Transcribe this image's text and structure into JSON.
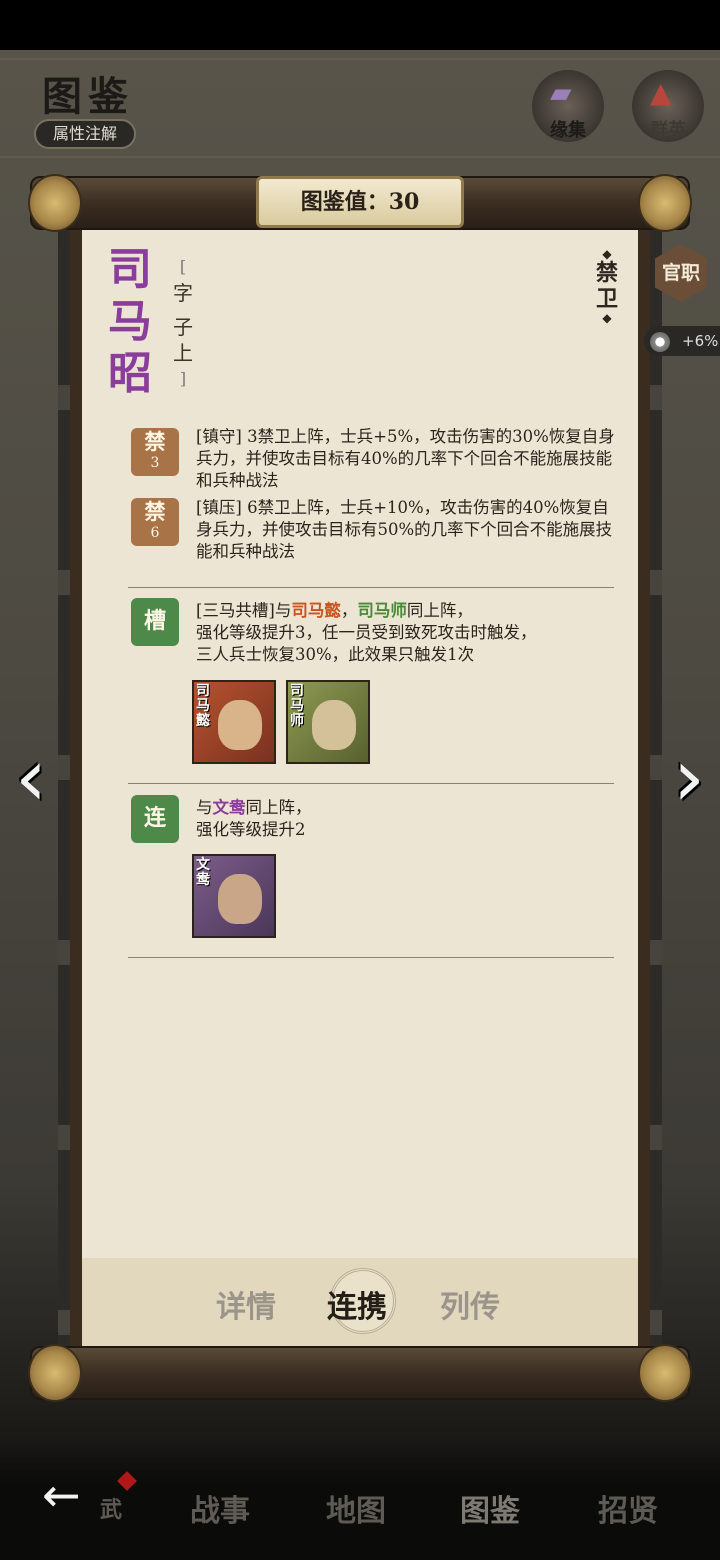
{
  "header": {
    "title": "图鉴",
    "attr_button": "属性注解",
    "icons": [
      {
        "name": "fate-collection-icon",
        "label": "缘集"
      },
      {
        "name": "heroes-icon",
        "label": "群英"
      }
    ]
  },
  "scroll": {
    "title": "图鉴值：30"
  },
  "hero": {
    "name_chars": [
      "司",
      "马",
      "昭"
    ],
    "courtesy": {
      "bracket_open": "[",
      "label": "字",
      "value_chars": [
        "子",
        "上"
      ],
      "bracket_close": "]"
    },
    "unit_chars": [
      "禁",
      "卫"
    ],
    "office_button": "官职",
    "bonus": "+6%"
  },
  "traits": [
    {
      "badge": "禁",
      "badge_num": "3",
      "text": "[镇守] 3禁卫上阵，士兵+5%，攻击伤害的30%恢复自身兵力，并使攻击目标有40%的几率下个回合不能施展技能和兵种战法"
    },
    {
      "badge": "禁",
      "badge_num": "6",
      "text": "[镇压] 6禁卫上阵，士兵+10%，攻击伤害的40%恢复自身兵力，并使攻击目标有50%的几率下个回合不能施展技能和兵种战法"
    }
  ],
  "combos": [
    {
      "badge": "槽",
      "line1_prefix": "[三马共槽]与",
      "hero1": "司马懿",
      "sep": "，",
      "hero2": "司马师",
      "line1_suffix": "同上阵，",
      "line2": "强化等级提升3，任一员受到致死攻击时触发，",
      "line3": "三人兵士恢复30%，此效果只触发1次",
      "portraits": [
        "司马懿",
        "司马师"
      ]
    },
    {
      "badge": "连",
      "line1_prefix": "与",
      "hero1": "文鸯",
      "line1_suffix": "同上阵，",
      "line2": "强化等级提升2",
      "portraits": [
        "文鸯"
      ]
    }
  ],
  "tabs": [
    "详情",
    "连携",
    "列传"
  ],
  "active_tab": "连携",
  "bottom_nav": [
    "战事",
    "地图",
    "图鉴",
    "招贤"
  ],
  "bottom_nav_partial": "武",
  "colors": {
    "hero_name": "#8a3d9c",
    "highlight_orange": "#c8541f",
    "highlight_green": "#4a8a3a",
    "badge_brown": "#a87346",
    "badge_green": "#4d8a4a"
  }
}
